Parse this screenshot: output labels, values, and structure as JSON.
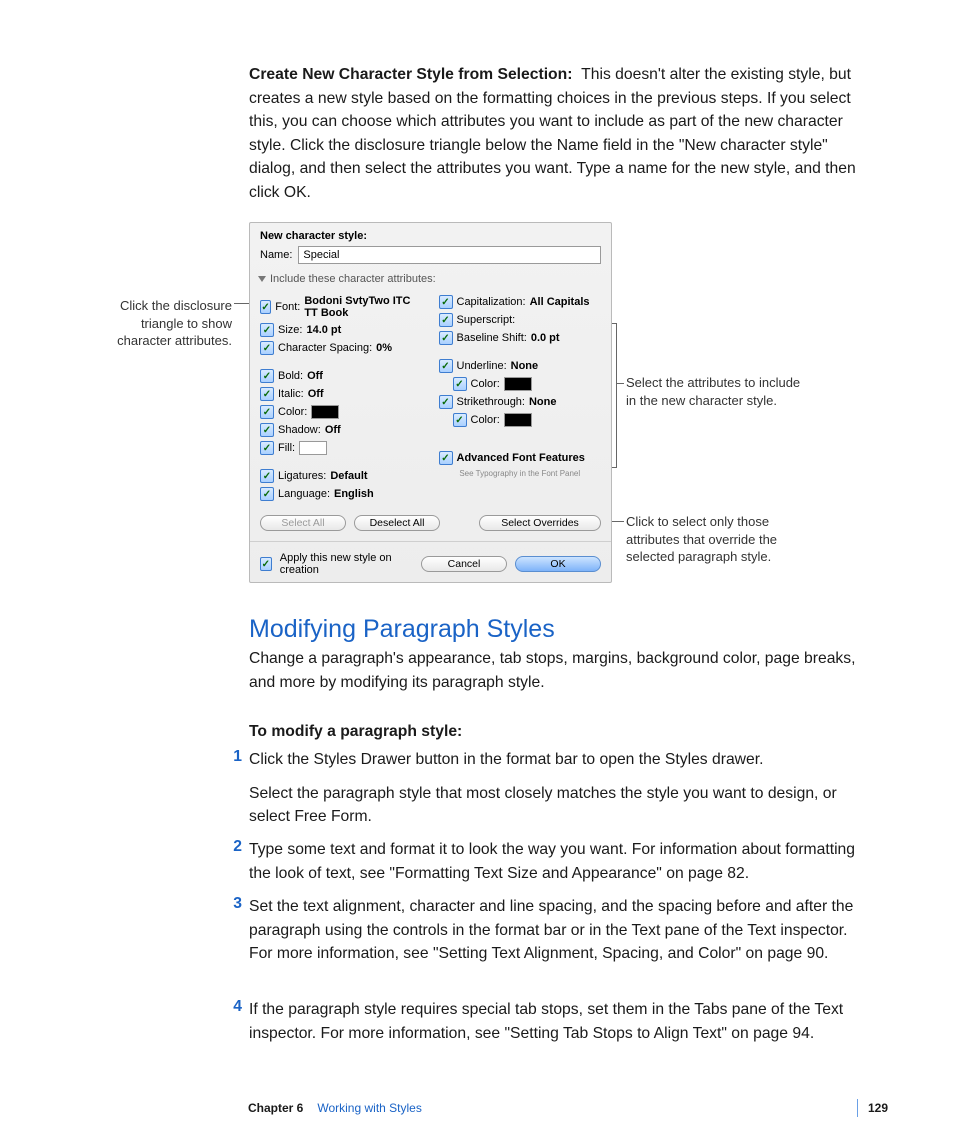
{
  "intro": {
    "bold_label": "Create New Character Style from Selection:",
    "text": "This doesn't alter the existing style, but creates a new style based on the formatting choices in the previous steps. If you select this, you can choose which attributes you want to include as part of the new character style. Click the disclosure triangle below the Name field in the \"New character style\" dialog, and then select the attributes you want. Type a name for the new style, and then click OK."
  },
  "callouts": {
    "left": "Click the disclosure triangle to show character attributes.",
    "right_top": "Select the attributes to include in the new character style.",
    "right_bottom": "Click to select only those attributes that override the selected paragraph style."
  },
  "dialog": {
    "title": "New character style:",
    "name_label": "Name:",
    "name_value": "Special",
    "disclosure": "Include these character attributes:",
    "left_col": [
      {
        "label": "Font:",
        "value": "Bodoni SvtyTwo ITC TT Book"
      },
      {
        "label": "Size:",
        "value": "14.0 pt"
      },
      {
        "label": "Character Spacing:",
        "value": "0%"
      }
    ],
    "left_col2": [
      {
        "label": "Bold:",
        "value": "Off"
      },
      {
        "label": "Italic:",
        "value": "Off"
      },
      {
        "label": "Color:",
        "swatch": "black"
      },
      {
        "label": "Shadow:",
        "value": "Off"
      },
      {
        "label": "Fill:",
        "swatch": "white"
      }
    ],
    "left_col3": [
      {
        "label": "Ligatures:",
        "value": "Default"
      },
      {
        "label": "Language:",
        "value": "English"
      }
    ],
    "right_col": [
      {
        "label": "Capitalization:",
        "value": "All Capitals"
      },
      {
        "label": "Superscript:",
        "value": ""
      },
      {
        "label": "Baseline Shift:",
        "value": "0.0 pt"
      }
    ],
    "right_col2": [
      {
        "label": "Underline:",
        "value": "None"
      },
      {
        "label": "Color:",
        "swatch": "black",
        "indent": true
      },
      {
        "label": "Strikethrough:",
        "value": "None"
      },
      {
        "label": "Color:",
        "swatch": "black",
        "indent": true
      }
    ],
    "right_col3_label": "Advanced Font Features",
    "right_col3_note": "See Typography in the Font Panel",
    "select_all": "Select All",
    "deselect_all": "Deselect All",
    "select_overrides": "Select Overrides",
    "apply_label": "Apply this new style on creation",
    "cancel": "Cancel",
    "ok": "OK"
  },
  "section": {
    "heading": "Modifying Paragraph Styles",
    "lead": "Change a paragraph's appearance, tab stops, margins, background color, page breaks, and more by modifying its paragraph style.",
    "subhead": "To modify a paragraph style:",
    "steps": [
      {
        "n": "1",
        "p1": "Click the Styles Drawer button in the format bar to open the Styles drawer.",
        "p2": "Select the paragraph style that most closely matches the style you want to design, or select Free Form."
      },
      {
        "n": "2",
        "p1": "Type some text and format it to look the way you want. For information about formatting the look of text, see \"Formatting Text Size and Appearance\" on page 82."
      },
      {
        "n": "3",
        "p1": "Set the text alignment, character and line spacing, and the spacing before and after the paragraph using the controls in the format bar or in the Text pane of the Text inspector. For more information, see \"Setting Text Alignment, Spacing, and Color\" on page 90."
      },
      {
        "n": "4",
        "p1": "If the paragraph style requires special tab stops, set them in the Tabs pane of the Text inspector. For more information, see \"Setting Tab Stops to Align Text\" on page 94."
      }
    ]
  },
  "footer": {
    "chapter_label": "Chapter 6",
    "chapter_title": "Working with Styles",
    "page": "129"
  }
}
